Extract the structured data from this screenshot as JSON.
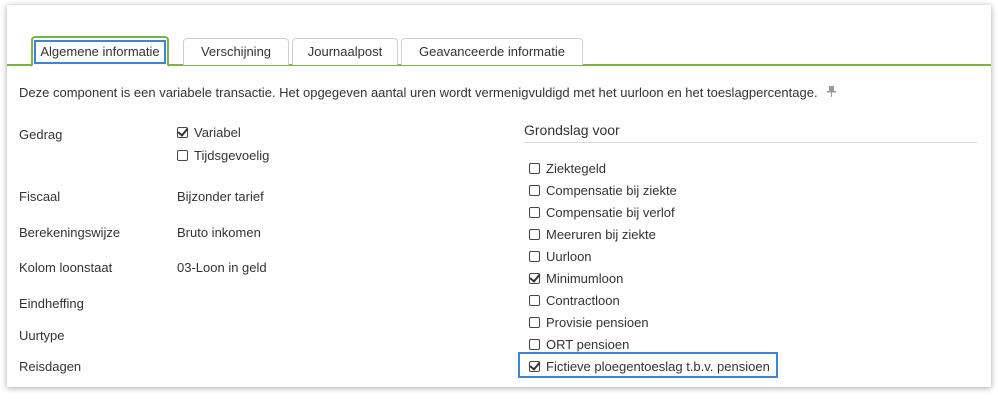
{
  "tabs": [
    {
      "label": "Algemene informatie",
      "active": true
    },
    {
      "label": "Verschijning",
      "active": false
    },
    {
      "label": "Journaalpost",
      "active": false
    },
    {
      "label": "Geavanceerde informatie",
      "active": false
    }
  ],
  "description": "Deze component is een variabele transactie. Het opgegeven aantal uren wordt vermenigvuldigd met het uurloon en het toeslagpercentage.",
  "pin_icon": "pin-icon",
  "fields": {
    "gedrag": {
      "label": "Gedrag",
      "options": [
        {
          "label": "Variabel",
          "checked": true
        },
        {
          "label": "Tijdsgevoelig",
          "checked": false
        }
      ]
    },
    "fiscaal": {
      "label": "Fiscaal",
      "value": "Bijzonder tarief"
    },
    "berekeningswijze": {
      "label": "Berekeningswijze",
      "value": "Bruto inkomen"
    },
    "kolom_loonstaat": {
      "label": "Kolom loonstaat",
      "value": "03-Loon in geld"
    },
    "eindheffing": {
      "label": "Eindheffing",
      "value": ""
    },
    "uurtype": {
      "label": "Uurtype",
      "value": ""
    },
    "reisdagen": {
      "label": "Reisdagen",
      "value": ""
    }
  },
  "grondslag": {
    "title": "Grondslag voor",
    "items": [
      {
        "label": "Ziektegeld",
        "checked": false
      },
      {
        "label": "Compensatie bij ziekte",
        "checked": false
      },
      {
        "label": "Compensatie bij verlof",
        "checked": false
      },
      {
        "label": "Meeruren bij ziekte",
        "checked": false
      },
      {
        "label": "Uurloon",
        "checked": false
      },
      {
        "label": "Minimumloon",
        "checked": true
      },
      {
        "label": "Contractloon",
        "checked": false
      },
      {
        "label": "Provisie pensioen",
        "checked": false
      },
      {
        "label": "ORT pensioen",
        "checked": false
      },
      {
        "label": "Fictieve ploegentoeslag t.b.v. pensioen",
        "checked": true
      }
    ]
  },
  "colors": {
    "accent_green": "#7cb342",
    "highlight_blue": "#3d84d8"
  }
}
